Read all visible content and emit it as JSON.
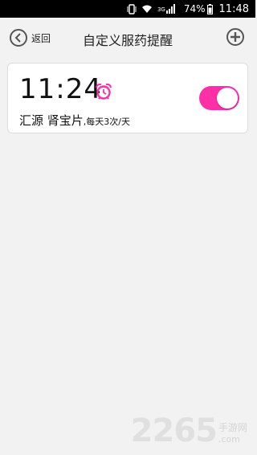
{
  "status_bar": {
    "network": "3G",
    "battery_percent": "74%",
    "time": "11:48",
    "icons": [
      "vibrate-icon",
      "wifi-icon",
      "signal-icon",
      "battery-icon"
    ]
  },
  "header": {
    "back_label": "返回",
    "title": "自定义服药提醒",
    "back_icon": "chevron-left-icon",
    "add_icon": "plus-icon"
  },
  "reminders": [
    {
      "time": "11:24",
      "medicine": "汇源 肾宝片",
      "frequency": ",每天3次/天",
      "enabled": true,
      "icon": "alarm-clock-icon"
    }
  ],
  "watermark": {
    "number": "2265",
    "chinese": "手游网",
    "domain": ".com"
  },
  "colors": {
    "accent": "#ff2fa8",
    "background": "#f2f2f2",
    "card": "#ffffff"
  }
}
